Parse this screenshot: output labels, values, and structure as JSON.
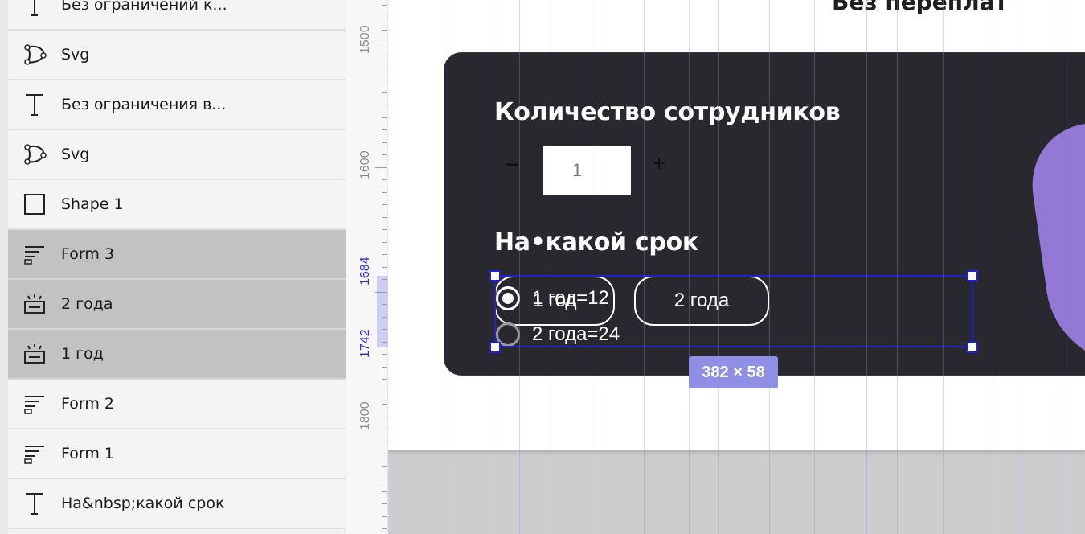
{
  "layers": [
    {
      "label": "Без ограничений к...",
      "icon": "text-icon",
      "selected": false
    },
    {
      "label": "Svg",
      "icon": "vector-path-icon",
      "selected": false
    },
    {
      "label": "Без ограничения в...",
      "icon": "text-icon",
      "selected": false
    },
    {
      "label": "Svg",
      "icon": "vector-path-icon",
      "selected": false
    },
    {
      "label": "Shape 1",
      "icon": "rectangle-icon",
      "selected": false
    },
    {
      "label": "Form 3",
      "icon": "form-icon",
      "selected": true
    },
    {
      "label": "2 года",
      "icon": "input-icon",
      "selected": true
    },
    {
      "label": "1 год",
      "icon": "input-icon",
      "selected": true
    },
    {
      "label": "Form 2",
      "icon": "form-icon",
      "selected": false
    },
    {
      "label": "Form 1",
      "icon": "form-icon",
      "selected": false
    },
    {
      "label": "На&nbsp;какой срок",
      "icon": "text-icon",
      "selected": false
    }
  ],
  "ruler": {
    "labels": [
      "1500",
      "1600",
      "1684",
      "1742",
      "1800"
    ]
  },
  "canvas": {
    "heading_fragment": "Без переплат",
    "employees_title": "Количество сотрудников",
    "minus_label": "−",
    "quantity_value": "1",
    "plus_label": "+",
    "term_title": "На•какой срок",
    "option_1_label": "1 год",
    "option_2_label": "2 года",
    "radio_1_label": "1 год=12",
    "radio_2_label": "2 года=24"
  },
  "selection": {
    "dimensions": "382 × 58",
    "color": "#1f1fd6"
  },
  "colors": {
    "card": "#2a282f",
    "accent_purple": "#9478d6",
    "guide": "#8c8ce6"
  }
}
